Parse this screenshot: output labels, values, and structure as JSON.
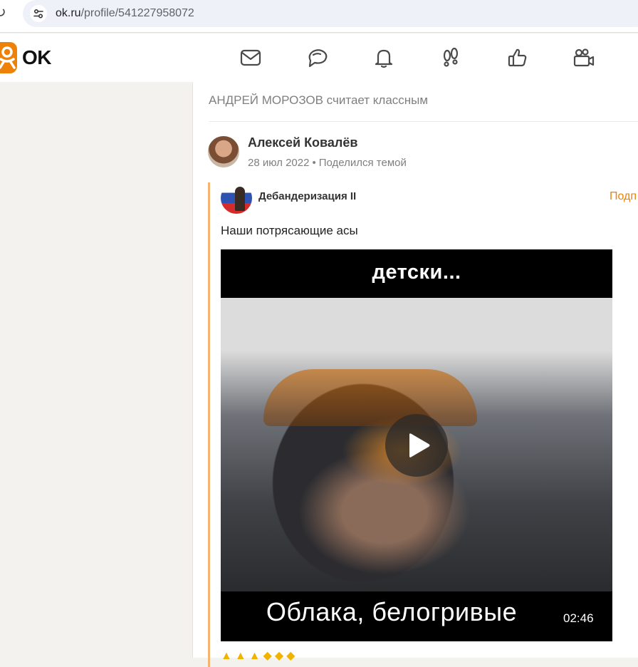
{
  "browser": {
    "url_host": "ok.ru",
    "url_path": "/profile/541227958072"
  },
  "header": {
    "logo_text": "OK",
    "nav_icons": [
      "messages-icon",
      "discussions-icon",
      "notifications-icon",
      "guests-icon",
      "events-icon",
      "video-icon"
    ],
    "brand_color": "#ee8208"
  },
  "feed": {
    "reason": "АНДРЕЙ МОРОЗОВ считает классным",
    "post": {
      "author": "Алексей Ковалёв",
      "date": "28 июл 2022",
      "action": "Поделился темой",
      "shared": {
        "group_name": "Дебандеризация II",
        "subscribe_label": "Подп",
        "text": "Наши потрясающие асы",
        "video": {
          "top_caption": "детски...",
          "bottom_caption": "Облака, белогривые",
          "duration": "02:46"
        }
      }
    }
  }
}
